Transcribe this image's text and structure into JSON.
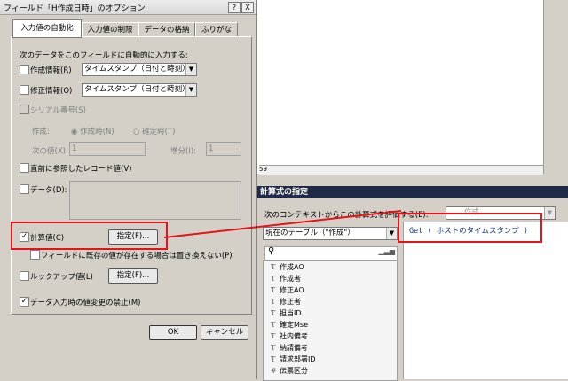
{
  "dialog": {
    "title": "フィールド「H作成日時」のオプション",
    "help": "?",
    "close": "X",
    "tabs": [
      "入力値の自動化",
      "入力値の制限",
      "データの格納",
      "ふりがな"
    ],
    "intro": "次のデータをこのフィールドに自動的に入力する:",
    "created": {
      "label": "作成情報(R)",
      "value": "タイムスタンプ（日付と時刻）"
    },
    "modified": {
      "label": "修正情報(O)",
      "value": "タイムスタンプ（日付と時刻）"
    },
    "serial": {
      "label": "シリアル番号(S)"
    },
    "generate_label": "作成:",
    "on_create": "作成時(N)",
    "on_commit": "確定時(T)",
    "next_label": "次の値(X):",
    "next_value": "1",
    "increment_label": "増分(I):",
    "increment_value": "1",
    "last_visited": "直前に参照したレコード値(V)",
    "data": "データ(D):",
    "calculated": {
      "label": "計算値(C)",
      "checked": true,
      "button": "指定(F)..."
    },
    "dont_replace": "フィールドに既存の値が存在する場合は置き換えない(P)",
    "lookup": {
      "label": "ルックアップ値(L)",
      "button": "指定(F)..."
    },
    "prohibit": "データ入力時の値変更の禁止(M)",
    "ok": "OK",
    "cancel": "キャンセル"
  },
  "scroll_marker": "59",
  "calc_dialog": {
    "title": "計算式の指定",
    "context_label": "次のコンテキストからこの計算式を評価する(E):",
    "context_value": "作成",
    "table_select": "現在のテーブル（\"作成\"）",
    "formula": "Get ( ホストのタイムスタンプ )",
    "fields": [
      "作成AO",
      "作成者",
      "修正AO",
      "修正者",
      "担当ID",
      "確定Mse",
      "社内備考",
      "納請備考",
      "請求部署ID",
      "伝票区分"
    ]
  },
  "colors": {
    "highlight": "#e5141b",
    "calc_title_bg": "#1f2a44",
    "dialog_bg": "#d4d0c8"
  }
}
